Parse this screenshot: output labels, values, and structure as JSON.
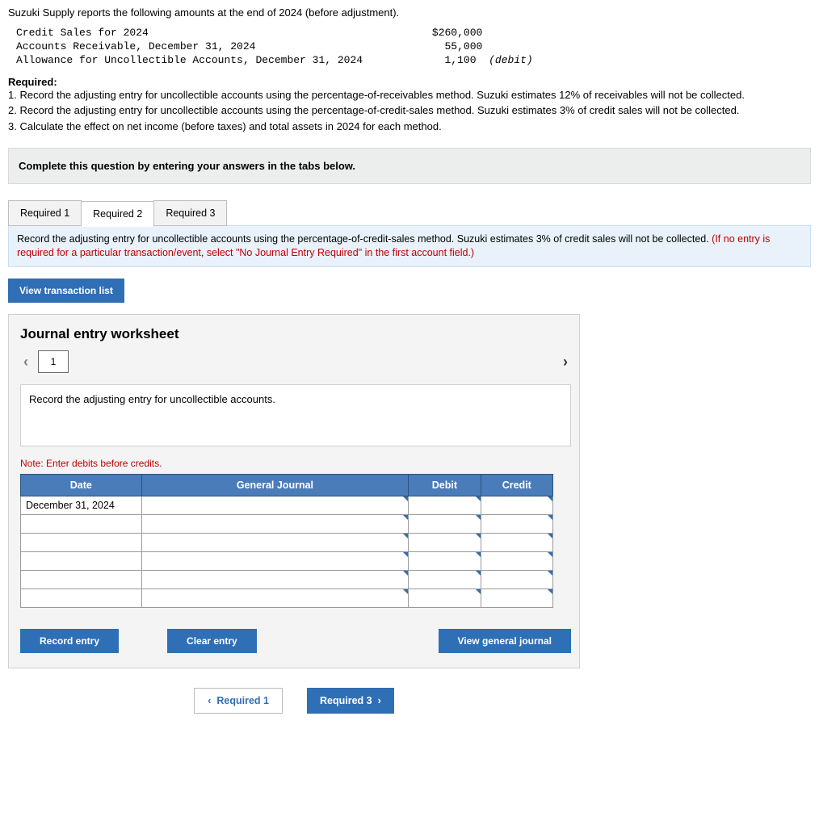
{
  "intro": "Suzuki Supply reports the following amounts at the end of 2024 (before adjustment).",
  "facts": {
    "l1_label": "Credit Sales for 2024",
    "l1_val": "$260,000",
    "l2_label": "Accounts Receivable, December 31, 2024",
    "l2_val": "55,000",
    "l3_label": "Allowance for Uncollectible Accounts, December 31, 2024",
    "l3_val": "1,100",
    "l3_note": "(debit)"
  },
  "required": {
    "heading": "Required:",
    "r1": "1. Record the adjusting entry for uncollectible accounts using the percentage-of-receivables method. Suzuki estimates 12% of receivables will not be collected.",
    "r2": "2. Record the adjusting entry for uncollectible accounts using the percentage-of-credit-sales method. Suzuki estimates 3% of credit sales will not be collected.",
    "r3": "3. Calculate the effect on net income (before taxes) and total assets in 2024 for each method."
  },
  "instr_bar": "Complete this question by entering your answers in the tabs below.",
  "tabs": {
    "t1": "Required 1",
    "t2": "Required 2",
    "t3": "Required 3",
    "active": "t2"
  },
  "tab_desc": {
    "black": "Record the adjusting entry for uncollectible accounts using the percentage-of-credit-sales method. Suzuki estimates 3% of credit sales will not be collected. ",
    "red": "(If no entry is required for a particular transaction/event, select \"No Journal Entry Required\" in the first account field.)"
  },
  "view_txn": "View transaction list",
  "ws": {
    "title": "Journal entry worksheet",
    "page": "1",
    "desc": "Record the adjusting entry for uncollectible accounts.",
    "note": "Note: Enter debits before credits."
  },
  "table": {
    "h_date": "Date",
    "h_gj": "General Journal",
    "h_debit": "Debit",
    "h_credit": "Credit",
    "date_val": "December 31, 2024"
  },
  "btns": {
    "record": "Record entry",
    "clear": "Clear entry",
    "view": "View general journal"
  },
  "footer": {
    "prev": "Required 1",
    "next": "Required 3"
  }
}
